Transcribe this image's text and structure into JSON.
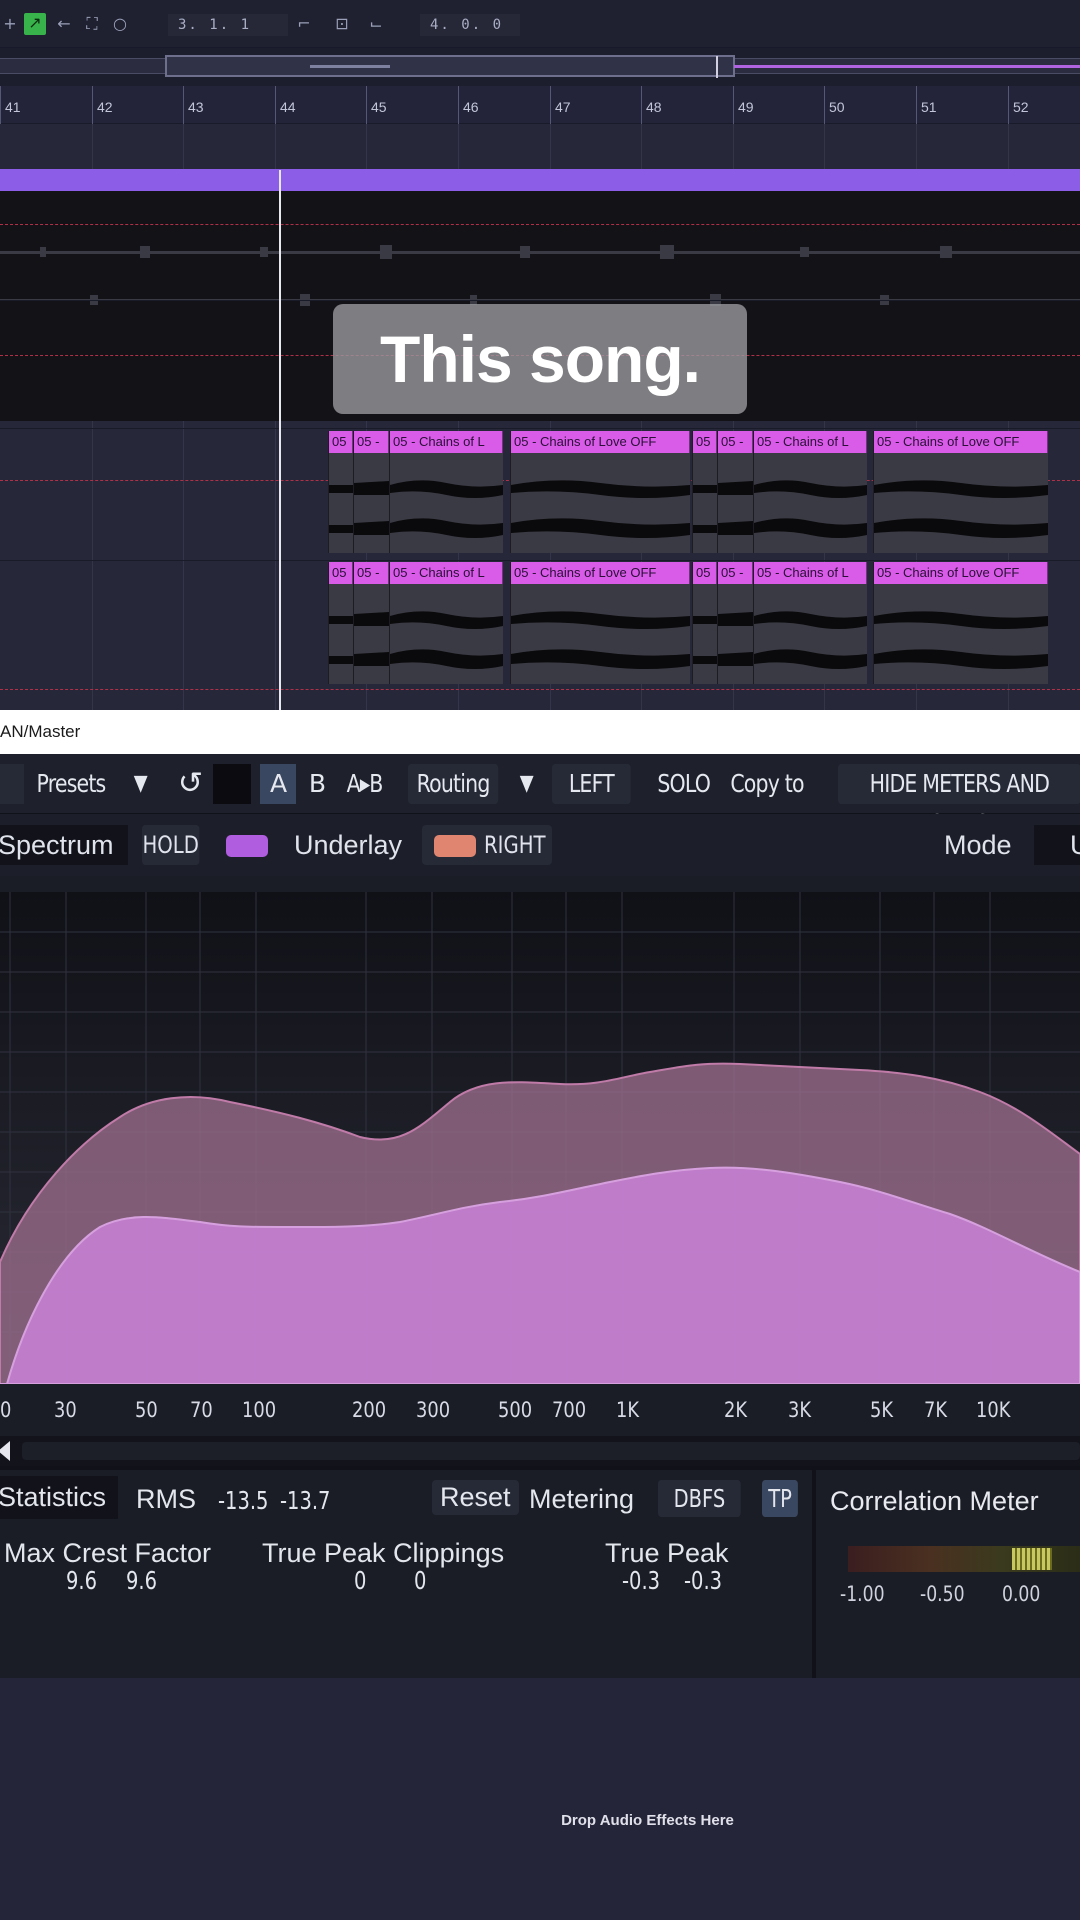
{
  "transport": {
    "position": "3. 1. 1",
    "length": "4. 0. 0"
  },
  "ruler": {
    "bars": [
      "41",
      "42",
      "43",
      "44",
      "45",
      "46",
      "47",
      "48",
      "49",
      "50",
      "51",
      "52"
    ]
  },
  "clips": {
    "labels": [
      "05",
      "05 -",
      "05 - Chains of L",
      "05 - Chains of Love OFF",
      "05",
      "05 -",
      "05 - Chains of L",
      "05 - Chains of Love OFF"
    ]
  },
  "caption": "This song.",
  "plugin": {
    "title": "AN/Master",
    "toolbar": {
      "presets": "Presets",
      "undo_icon": "undo-icon",
      "a": "A",
      "b": "B",
      "ab": "A▸B",
      "routing": "Routing",
      "left": "LEFT",
      "solo": "SOLO",
      "copy_to": "Copy to",
      "hide": "HIDE METERS AND STATS"
    },
    "spectrum_bar": {
      "spectrum": "Spectrum",
      "hold": "HOLD",
      "underlay": "Underlay",
      "right": "RIGHT",
      "mode": "Mode",
      "mode_value": "U"
    },
    "colors": {
      "main_fill": "#c47fd0",
      "underlay_fill": "#a07090",
      "hold_swatch": "#b05de0",
      "right_swatch": "#e08670"
    },
    "freq_labels": [
      "0",
      "30",
      "50",
      "70",
      "100",
      "200",
      "300",
      "500",
      "700",
      "1K",
      "2K",
      "3K",
      "5K",
      "7K",
      "10K"
    ],
    "stats": {
      "title": "Statistics",
      "rms_label": "RMS",
      "rms_l": "-13.5",
      "rms_r": "-13.7",
      "reset": "Reset",
      "metering_label": "Metering",
      "metering_value": "DBFS",
      "tp": "TP",
      "crest_label": "Max Crest Factor",
      "crest_l": "9.6",
      "crest_r": "9.6",
      "clip_label": "True Peak Clippings",
      "clip_l": "0",
      "clip_r": "0",
      "peak_label": "True Peak",
      "peak_l": "-0.3",
      "peak_r": "-0.3"
    },
    "correlation": {
      "title": "Correlation Meter",
      "scale": [
        "-1.00",
        "-0.50",
        "0.00"
      ]
    }
  },
  "bottom": {
    "drop_text": "Drop Audio Effects Here"
  }
}
